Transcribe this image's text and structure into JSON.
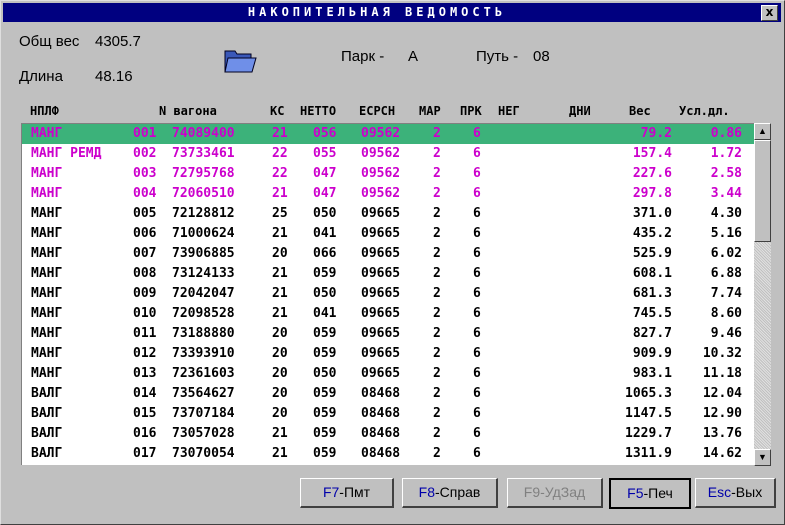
{
  "window": {
    "title": "НАКОПИТЕЛЬНАЯ ВЕДОМОСТЬ",
    "close_label": "x"
  },
  "info": {
    "weight_label": "Общ вес",
    "weight_value": "4305.7",
    "length_label": "Длина",
    "length_value": "48.16",
    "park_label": "Парк -",
    "park_value": "А",
    "path_label": "Путь -",
    "path_value": "08"
  },
  "icons": {
    "folder": "folder-icon",
    "scroll_up": "arrow-up-icon",
    "scroll_down": "arrow-down-icon"
  },
  "columns": [
    "НПЛФ",
    "N вагона",
    "КС",
    "НЕТТО",
    "ЕСРСН",
    "МАР",
    "ПРК",
    "НЕГ",
    "ДНИ",
    "Вес",
    "Усл.дл."
  ],
  "colors": {
    "selected_row": "#3cb27a",
    "highlight_text": "#cc00cc",
    "title_bar": "#000080"
  },
  "rows": [
    [
      "МАНГ",
      "001",
      "74089400",
      "21",
      "056",
      "09562",
      "2",
      "6",
      "79.2",
      "0.86"
    ],
    [
      "МАНГ РЕМД",
      "002",
      "73733461",
      "22",
      "055",
      "09562",
      "2",
      "6",
      "157.4",
      "1.72"
    ],
    [
      "МАНГ",
      "003",
      "72795768",
      "22",
      "047",
      "09562",
      "2",
      "6",
      "227.6",
      "2.58"
    ],
    [
      "МАНГ",
      "004",
      "72060510",
      "21",
      "047",
      "09562",
      "2",
      "6",
      "297.8",
      "3.44"
    ],
    [
      "МАНГ",
      "005",
      "72128812",
      "25",
      "050",
      "09665",
      "2",
      "6",
      "371.0",
      "4.30"
    ],
    [
      "МАНГ",
      "006",
      "71000624",
      "21",
      "041",
      "09665",
      "2",
      "6",
      "435.2",
      "5.16"
    ],
    [
      "МАНГ",
      "007",
      "73906885",
      "20",
      "066",
      "09665",
      "2",
      "6",
      "525.9",
      "6.02"
    ],
    [
      "МАНГ",
      "008",
      "73124133",
      "21",
      "059",
      "09665",
      "2",
      "6",
      "608.1",
      "6.88"
    ],
    [
      "МАНГ",
      "009",
      "72042047",
      "21",
      "050",
      "09665",
      "2",
      "6",
      "681.3",
      "7.74"
    ],
    [
      "МАНГ",
      "010",
      "72098528",
      "21",
      "041",
      "09665",
      "2",
      "6",
      "745.5",
      "8.60"
    ],
    [
      "МАНГ",
      "011",
      "73188880",
      "20",
      "059",
      "09665",
      "2",
      "6",
      "827.7",
      "9.46"
    ],
    [
      "МАНГ",
      "012",
      "73393910",
      "20",
      "059",
      "09665",
      "2",
      "6",
      "909.9",
      "10.32"
    ],
    [
      "МАНГ",
      "013",
      "72361603",
      "20",
      "050",
      "09665",
      "2",
      "6",
      "983.1",
      "11.18"
    ],
    [
      "ВАЛГ",
      "014",
      "73564627",
      "20",
      "059",
      "08468",
      "2",
      "6",
      "1065.3",
      "12.04"
    ],
    [
      "ВАЛГ",
      "015",
      "73707184",
      "20",
      "059",
      "08468",
      "2",
      "6",
      "1147.5",
      "12.90"
    ],
    [
      "ВАЛГ",
      "016",
      "73057028",
      "21",
      "059",
      "08468",
      "2",
      "6",
      "1229.7",
      "13.76"
    ],
    [
      "ВАЛГ",
      "017",
      "73070054",
      "21",
      "059",
      "08468",
      "2",
      "6",
      "1311.9",
      "14.62"
    ]
  ],
  "highlighted_rows": [
    0,
    1,
    2,
    3
  ],
  "selected_row": 0,
  "buttons": [
    {
      "key": "F7",
      "label": "-Пмт",
      "enabled": true,
      "active": false
    },
    {
      "key": "F8",
      "label": "-Справ",
      "enabled": true,
      "active": false
    },
    {
      "key": "F9",
      "label": "-УдЗад",
      "enabled": false,
      "active": false
    },
    {
      "key": "F5",
      "label": "-Печ",
      "enabled": true,
      "active": true
    },
    {
      "key": "Esc",
      "label": "-Вых",
      "enabled": true,
      "active": false
    }
  ]
}
